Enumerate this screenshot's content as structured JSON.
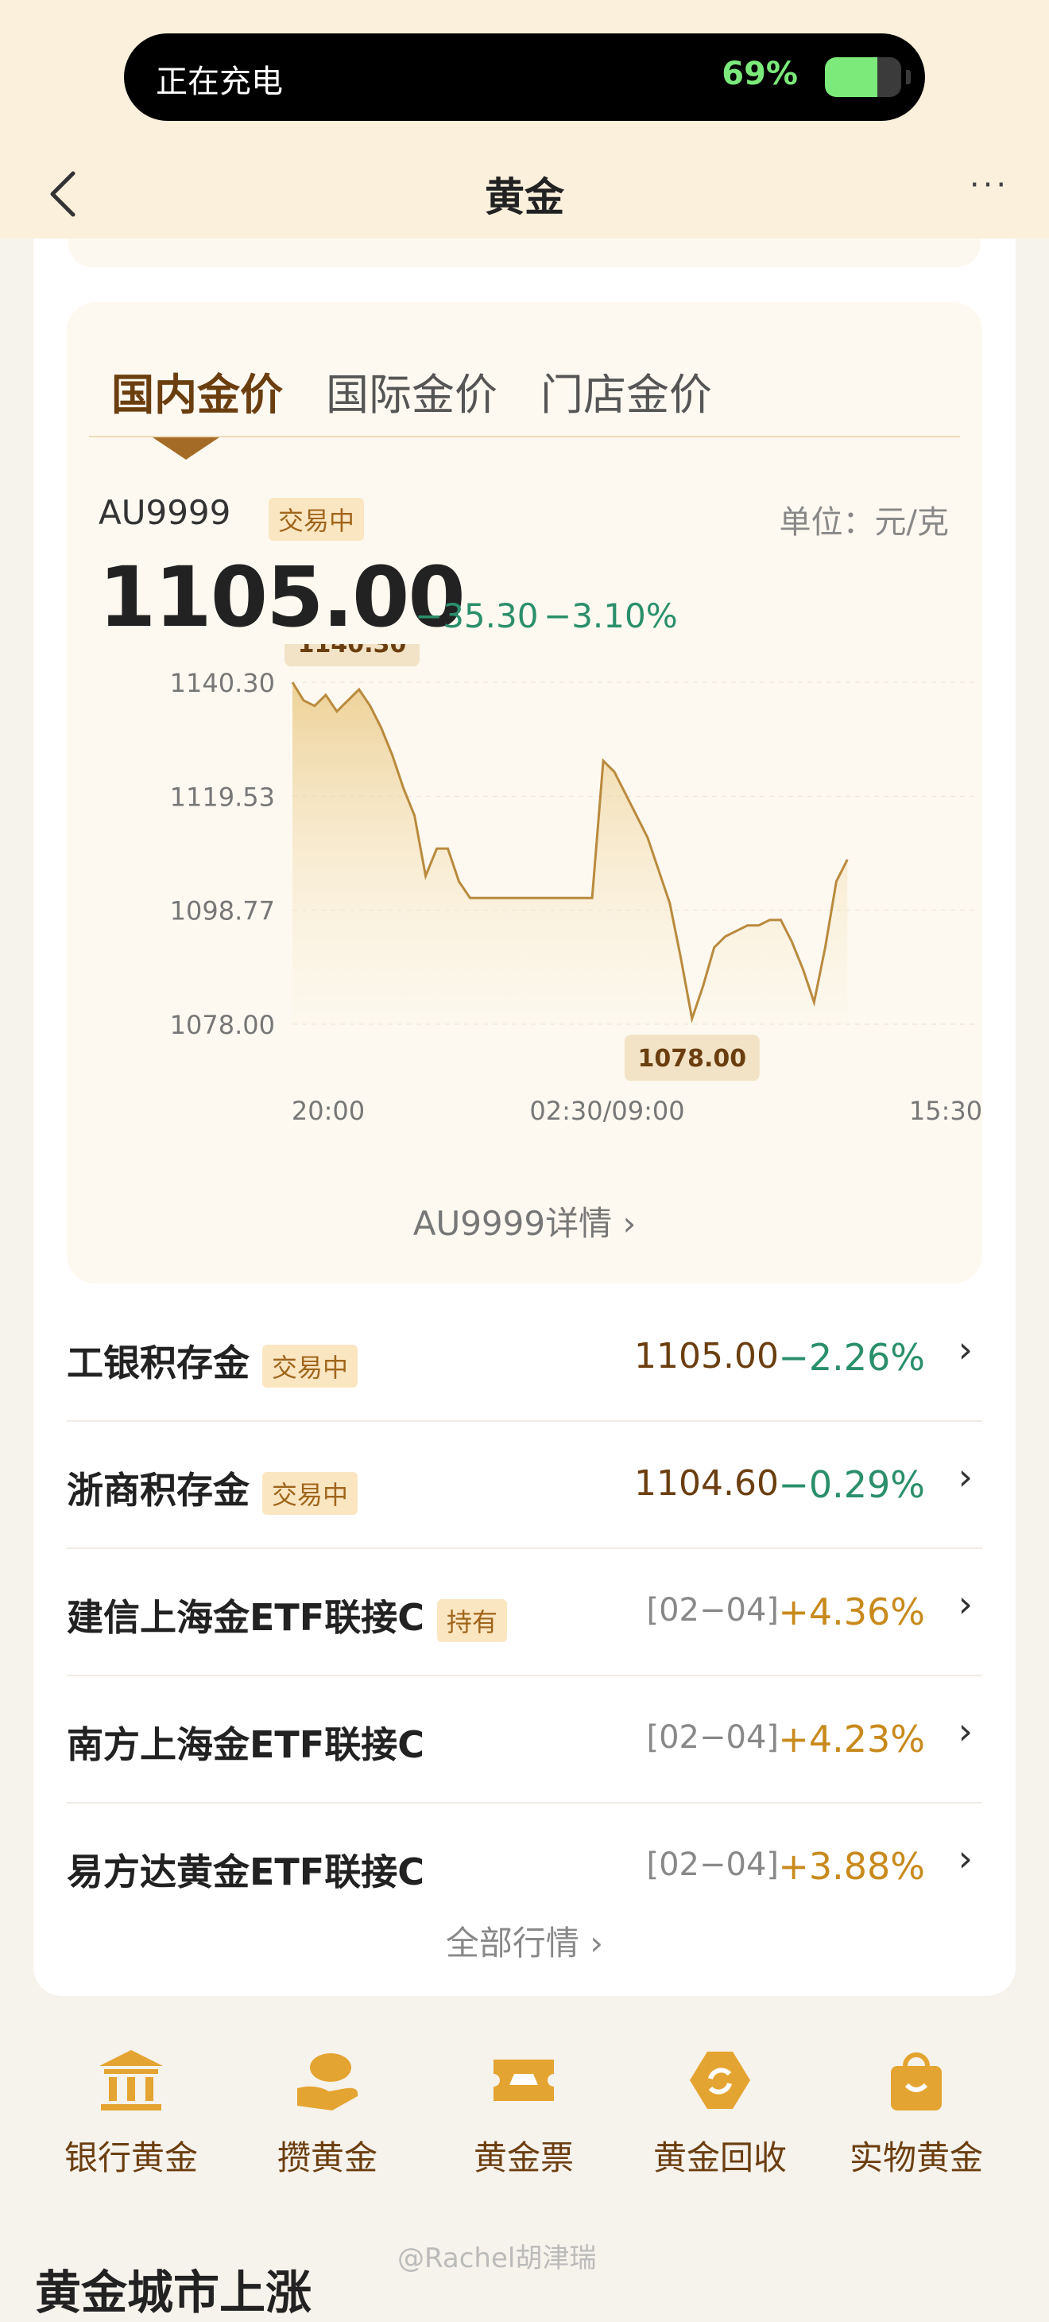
{
  "status_bar": {
    "text": "正在充电",
    "battery_pct": "69%",
    "battery_level": 0.69
  },
  "nav": {
    "title": "黄金",
    "more": "···"
  },
  "tabs": [
    {
      "label": "国内金价",
      "active": true
    },
    {
      "label": "国际金价",
      "active": false
    },
    {
      "label": "门店金价",
      "active": false
    }
  ],
  "quote": {
    "code": "AU9999",
    "status": "交易中",
    "unit": "单位：元/克",
    "price": "1105.00",
    "change": "−35.30",
    "change_pct": "−3.10%"
  },
  "chart_data": {
    "type": "line",
    "xlabels": [
      "20:00",
      "02:30/09:00",
      "15:30"
    ],
    "ylabels": [
      "1140.30",
      "1119.53",
      "1098.77",
      "1078.00"
    ],
    "ylim": [
      1078.0,
      1140.3
    ],
    "grid": true,
    "max_label": "1140.30",
    "min_label": "1078.00",
    "x": [
      0,
      2,
      4,
      6,
      8,
      10,
      12,
      14,
      16,
      18,
      20,
      22,
      24,
      26,
      28,
      30,
      32,
      34,
      36,
      38,
      40,
      42,
      44,
      46,
      48,
      50,
      52,
      54,
      56,
      58,
      60,
      62,
      64,
      66,
      68,
      70,
      72,
      74,
      76,
      78,
      80,
      82,
      84,
      86,
      88,
      90,
      92,
      94,
      96,
      98,
      100
    ],
    "values": [
      1140.3,
      1137,
      1136,
      1138,
      1135,
      1137,
      1139,
      1136,
      1132,
      1127,
      1121,
      1116,
      1105,
      1110,
      1110,
      1104,
      1101,
      1101,
      1101,
      1101,
      1101,
      1101,
      1101,
      1101,
      1101,
      1101,
      1101,
      1101,
      1126,
      1124,
      1120,
      1116,
      1112,
      1106,
      1100,
      1090,
      1079,
      1085,
      1092,
      1094,
      1095,
      1096,
      1096,
      1097,
      1097,
      1093,
      1088,
      1082,
      1092,
      1104,
      1108
    ]
  },
  "detail_link": "AU9999详情 ›",
  "products": [
    {
      "name": "工银积存金",
      "badge": "交易中",
      "value": "1105.00",
      "date": "",
      "pct": "−2.26%",
      "dir": "down"
    },
    {
      "name": "浙商积存金",
      "badge": "交易中",
      "value": "1104.60",
      "date": "",
      "pct": "−0.29%",
      "dir": "down"
    },
    {
      "name": "建信上海金ETF联接C",
      "badge": "持有",
      "value": "",
      "date": "[02−04]",
      "pct": "+4.36%",
      "dir": "up"
    },
    {
      "name": "南方上海金ETF联接C",
      "badge": "",
      "value": "",
      "date": "[02−04]",
      "pct": "+4.23%",
      "dir": "up"
    },
    {
      "name": "易方达黄金ETF联接C",
      "badge": "",
      "value": "",
      "date": "[02−04]",
      "pct": "+3.88%",
      "dir": "up"
    }
  ],
  "all_link": "全部行情 ›",
  "quick_links": [
    {
      "label": "银行黄金",
      "icon": "bank-icon"
    },
    {
      "label": "攒黄金",
      "icon": "hand-coin-icon"
    },
    {
      "label": "黄金票",
      "icon": "ticket-icon"
    },
    {
      "label": "黄金回收",
      "icon": "recycle-icon"
    },
    {
      "label": "实物黄金",
      "icon": "shopping-bag-icon"
    }
  ],
  "bottom_title": "黄金城市上涨",
  "watermark": "@Rachel胡津瑞",
  "colors": {
    "accent": "#c99a45",
    "down": "#2a8f6a",
    "up": "#c88a1c",
    "brown": "#6b3e10"
  }
}
